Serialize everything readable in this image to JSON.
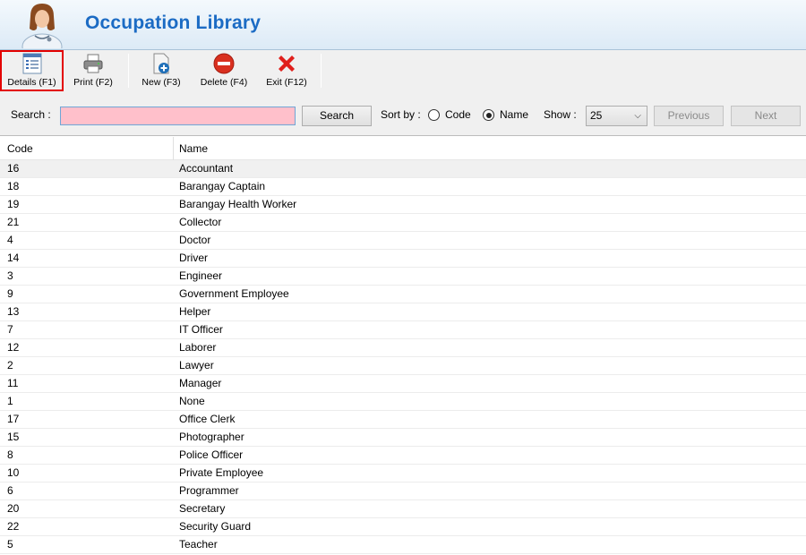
{
  "header": {
    "title": "Occupation Library",
    "avatar_icon": "doctor-avatar-icon"
  },
  "toolbar": {
    "details": "Details (F1)",
    "print": "Print (F2)",
    "new": "New (F3)",
    "delete": "Delete (F4)",
    "exit": "Exit (F12)"
  },
  "search": {
    "label": "Search :",
    "value": "",
    "button": "Search",
    "sort_label": "Sort by :",
    "sort_code": "Code",
    "sort_name": "Name",
    "sort_selected": "Name",
    "show_label": "Show :",
    "show_value": "25",
    "previous": "Previous",
    "next": "Next"
  },
  "grid": {
    "columns": [
      "Code",
      "Name"
    ],
    "rows": [
      {
        "code": "16",
        "name": "Accountant"
      },
      {
        "code": "18",
        "name": "Barangay Captain"
      },
      {
        "code": "19",
        "name": "Barangay Health Worker"
      },
      {
        "code": "21",
        "name": "Collector"
      },
      {
        "code": "4",
        "name": "Doctor"
      },
      {
        "code": "14",
        "name": "Driver"
      },
      {
        "code": "3",
        "name": "Engineer"
      },
      {
        "code": "9",
        "name": "Government Employee"
      },
      {
        "code": "13",
        "name": "Helper"
      },
      {
        "code": "7",
        "name": "IT Officer"
      },
      {
        "code": "12",
        "name": "Laborer"
      },
      {
        "code": "2",
        "name": "Lawyer"
      },
      {
        "code": "11",
        "name": "Manager"
      },
      {
        "code": "1",
        "name": "None"
      },
      {
        "code": "17",
        "name": "Office Clerk"
      },
      {
        "code": "15",
        "name": "Photographer"
      },
      {
        "code": "8",
        "name": "Police Officer"
      },
      {
        "code": "10",
        "name": "Private Employee"
      },
      {
        "code": "6",
        "name": "Programmer"
      },
      {
        "code": "20",
        "name": "Secretary"
      },
      {
        "code": "22",
        "name": "Security Guard"
      },
      {
        "code": "5",
        "name": "Teacher"
      }
    ]
  },
  "colors": {
    "title": "#1b6bc4",
    "search_bg": "#ffc0cb",
    "highlight": "#e30000"
  }
}
